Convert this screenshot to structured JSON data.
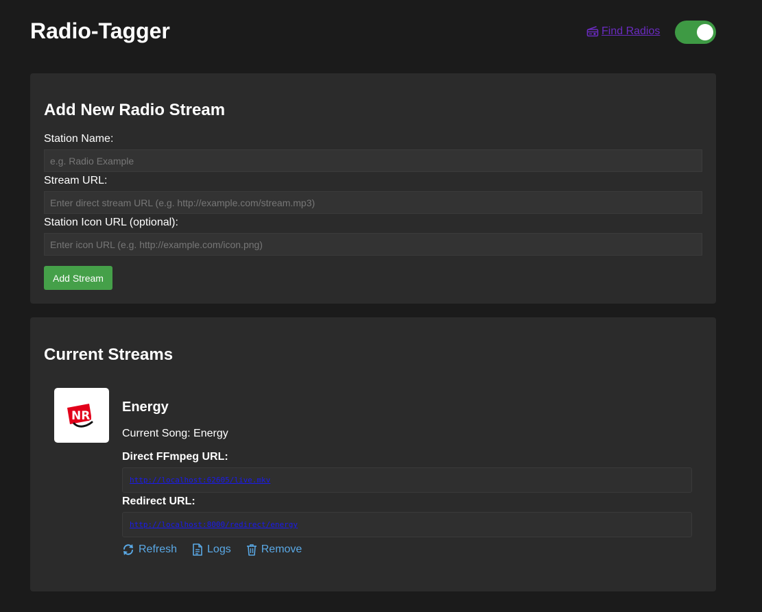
{
  "header": {
    "title": "Radio-Tagger",
    "find_radios_label": "Find Radios",
    "theme_toggle_on": true
  },
  "add_form": {
    "heading": "Add New Radio Stream",
    "station_name_label": "Station Name:",
    "station_name_placeholder": "e.g. Radio Example",
    "station_name_value": "",
    "stream_url_label": "Stream URL:",
    "stream_url_placeholder": "Enter direct stream URL (e.g. http://example.com/stream.mp3)",
    "stream_url_value": "",
    "icon_url_label": "Station Icon URL (optional):",
    "icon_url_placeholder": "Enter icon URL (e.g. http://example.com/icon.png)",
    "icon_url_value": "",
    "submit_label": "Add Stream"
  },
  "streams": {
    "heading": "Current Streams",
    "items": [
      {
        "name": "Energy",
        "logo_icon": "nrj-logo",
        "current_song": "Current Song: Energy",
        "ffmpeg_label": "Direct FFmpeg URL:",
        "ffmpeg_url": "http://localhost:62605/live.mkv",
        "redirect_label": "Redirect URL:",
        "redirect_url": "http://localhost:8000/redirect/energy",
        "actions": {
          "refresh": "Refresh",
          "logs": "Logs",
          "remove": "Remove"
        }
      }
    ]
  },
  "colors": {
    "background": "#1b1b1b",
    "card": "#2b2b2b",
    "accent_green": "#45a049",
    "link_purple": "#6a2bc0",
    "action_blue": "#5aa9e6",
    "url_link": "#1a1aee"
  }
}
